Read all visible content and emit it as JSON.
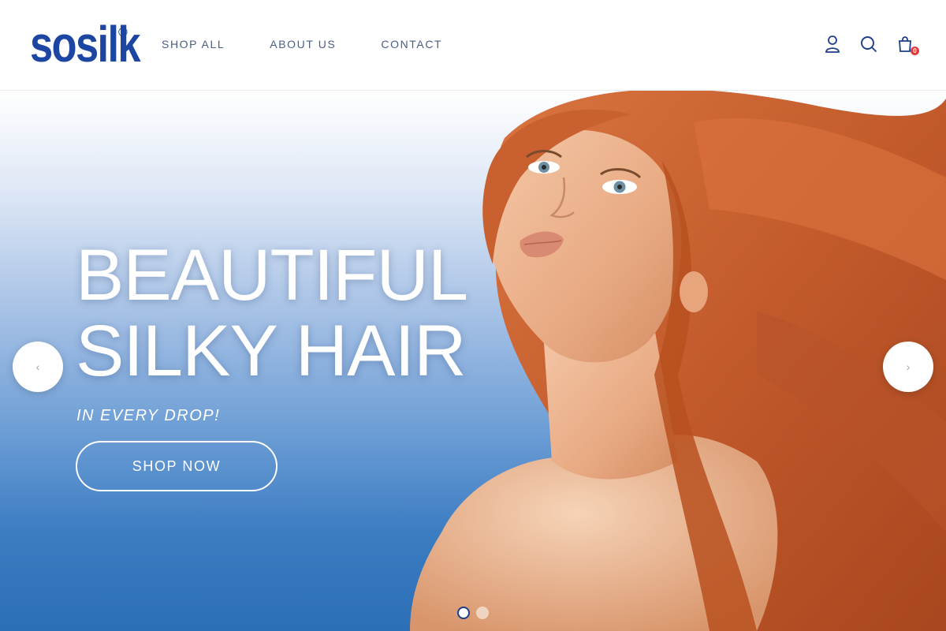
{
  "brand": {
    "name": "sosilk",
    "registered": "®",
    "color": "#1d46a3"
  },
  "nav": {
    "items": [
      {
        "label": "SHOP ALL"
      },
      {
        "label": "ABOUT US"
      },
      {
        "label": "CONTACT"
      }
    ]
  },
  "header_icons": {
    "account": "user-icon",
    "search": "search-icon",
    "cart": "cart-icon",
    "cart_count": "0"
  },
  "hero": {
    "title_line1": "BEAUTIFUL",
    "title_line2": "SILKY HAIR",
    "subtitle": "IN EVERY DROP!",
    "cta_label": "SHOP NOW",
    "prev_icon": "chevron-left-icon",
    "next_icon": "chevron-right-icon",
    "prev_glyph": "‹",
    "next_glyph": "›",
    "slides_total": 2,
    "active_slide": 1
  },
  "colors": {
    "nav_text": "#4a5f86",
    "badge": "#e23b3b",
    "hair": "#c65a2c",
    "gradient_bottom": "#2b6fb6"
  }
}
